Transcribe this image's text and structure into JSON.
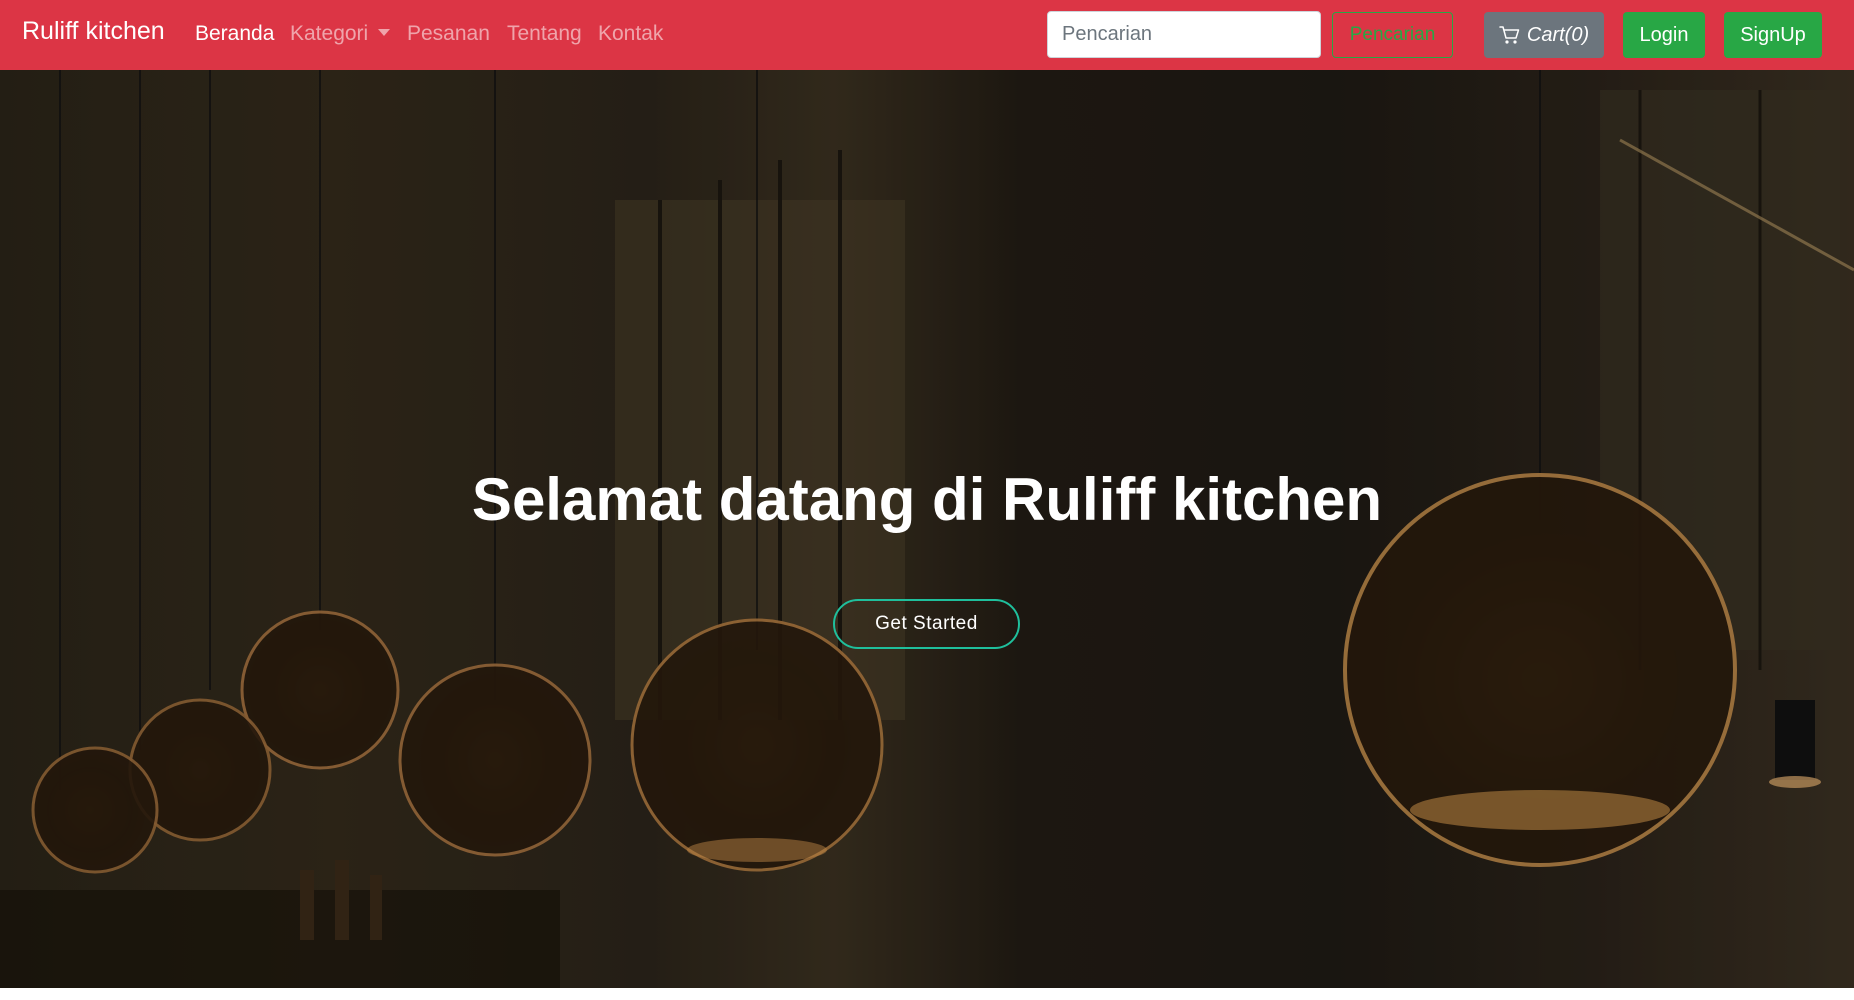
{
  "navbar": {
    "brand": "Ruliff kitchen",
    "links": [
      {
        "label": "Beranda",
        "active": true
      },
      {
        "label": "Kategori",
        "dropdown": true
      },
      {
        "label": "Pesanan"
      },
      {
        "label": "Tentang"
      },
      {
        "label": "Kontak"
      }
    ],
    "search": {
      "placeholder": "Pencarian",
      "value": "",
      "button_label": "Pencarian"
    },
    "cart": {
      "label": "Cart(0)",
      "icon": "cart-icon"
    },
    "login_label": "Login",
    "signup_label": "SignUp"
  },
  "hero": {
    "title": "Selamat datang di Ruliff kitchen",
    "cta_label": "Get Started"
  },
  "colors": {
    "navbar": "#dc3545",
    "success": "#28a745",
    "secondary": "#6c757d",
    "cta_border": "#1fbf9c"
  }
}
